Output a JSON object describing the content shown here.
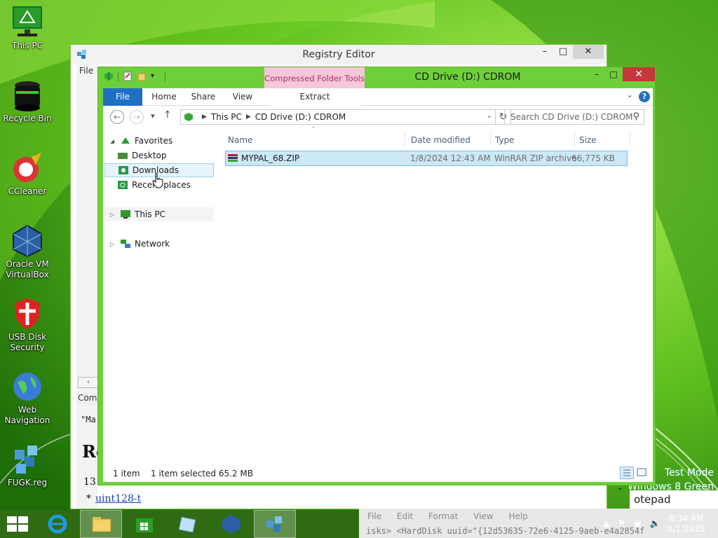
{
  "desktop": {
    "icons": [
      {
        "name": "desktop-icon-this-pc",
        "label": "This PC"
      },
      {
        "name": "desktop-icon-recycle-bin",
        "label": "Recycle Bin"
      },
      {
        "name": "desktop-icon-ccleaner",
        "label": "CCleaner"
      },
      {
        "name": "desktop-icon-virtualbox",
        "label": "Oracle VM\nVirtualBox"
      },
      {
        "name": "desktop-icon-usb-disk-security",
        "label": "USB Disk\nSecurity"
      },
      {
        "name": "desktop-icon-web-navigation",
        "label": "Web\nNavigation"
      },
      {
        "name": "desktop-icon-fugk-reg",
        "label": "FUGK.reg"
      }
    ],
    "watermark": {
      "line1": "Test Mode",
      "line2": "Windows 8 Green"
    }
  },
  "regedit": {
    "title": "Registry Editor",
    "menu_file": "File",
    "status_text": "Comp",
    "bg_line1": "\"Ma",
    "bg_heading": "Re",
    "bg_line3": "13",
    "bg_bullet": "*",
    "bg_link": "uint128-t"
  },
  "notepad": {
    "title": "otepad",
    "menu": [
      "File",
      "Edit",
      "Format",
      "View",
      "Help"
    ],
    "line": "isks>      <HardDisk uuid=\"{12d53635-72e6-4125-9aeb-e4a2854f"
  },
  "explorer": {
    "title": "CD Drive (D:) CDROM",
    "context_tab": "Compressed Folder Tools",
    "ribbon": {
      "file": "File",
      "home": "Home",
      "share": "Share",
      "view": "View",
      "extract": "Extract",
      "help": "?"
    },
    "address": {
      "parts": [
        "This PC",
        "CD Drive (D:) CDROM"
      ]
    },
    "search": {
      "placeholder": "Search CD Drive (D:) CDROM"
    },
    "nav": {
      "favorites": "Favorites",
      "desktop": "Desktop",
      "downloads": "Downloads",
      "recent": "Recent places",
      "this_pc": "This PC",
      "network": "Network"
    },
    "columns": {
      "name": "Name",
      "date": "Date modified",
      "type": "Type",
      "size": "Size"
    },
    "files": [
      {
        "name": "MYPAL_68.ZIP",
        "date": "1/8/2024 12:43 AM",
        "type": "WinRAR ZIP archive",
        "size": "66,775 KB"
      }
    ],
    "status": {
      "items": "1 item",
      "selected": "1 item selected  65.2 MB"
    }
  },
  "tray": {
    "time": "6:34 AM",
    "date": "1/1/2025"
  },
  "colors": {
    "window_frame": "#6fcf3a",
    "ribbon_file": "#1f6fc5",
    "selection": "#cce8f7",
    "close": "#c7363a",
    "context_tab": "#f6c6d9"
  }
}
